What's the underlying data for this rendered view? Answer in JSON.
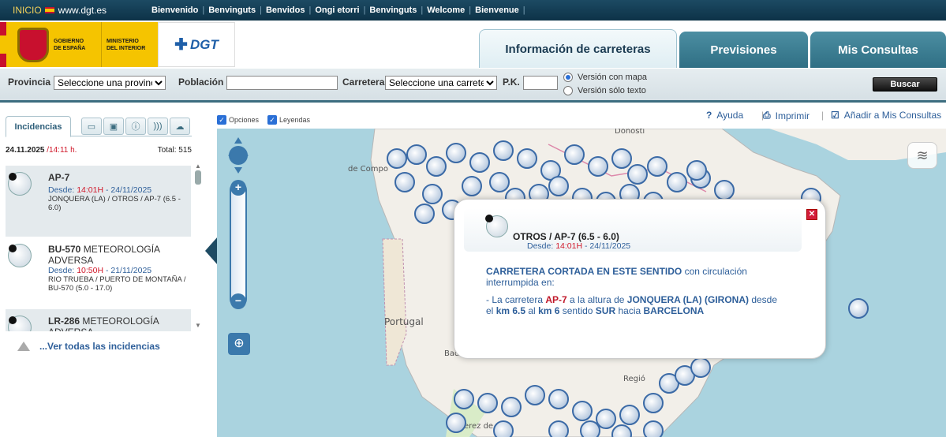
{
  "topbar": {
    "inicio": "INICIO",
    "site": "www.dgt.es",
    "languages": [
      "Bienvenido",
      "Benvinguts",
      "Benvidos",
      "Ongi etorri",
      "Benvinguts",
      "Welcome",
      "Bienvenue"
    ]
  },
  "header": {
    "gob_line1": "GOBIERNO",
    "gob_line2": "DE ESPAÑA",
    "min_line1": "MINISTERIO",
    "min_line2": "DEL INTERIOR",
    "dgt": "DGT",
    "tabs": [
      {
        "label": "Información de carreteras",
        "active": true
      },
      {
        "label": "Previsiones",
        "active": false
      },
      {
        "label": "Mis Consultas",
        "active": false
      }
    ]
  },
  "search": {
    "provincia_label": "Provincia",
    "provincia_value": "Seleccione una provincia",
    "poblacion_label": "Población",
    "poblacion_value": "",
    "carretera_label": "Carretera",
    "carretera_value": "Seleccione una carretera",
    "pk_label": "P.K.",
    "pk_value": "",
    "radio_map": "Versión con mapa",
    "radio_text": "Versión sólo texto",
    "radio_selected": "map",
    "buscar": "Buscar"
  },
  "left": {
    "tab_main": "Incidencias",
    "tab_icons": [
      "camera-icon",
      "message-sign-icon",
      "info-icon",
      "radio-icon",
      "weather-icon"
    ],
    "date": "24.11.2025",
    "time": "/14:11 h.",
    "total": "Total: 515",
    "incidents": [
      {
        "road": "AP-7",
        "type": "",
        "desde_prefix": "Desde: ",
        "hour": "14:01H",
        "date": " - 24/11/2025",
        "location": "JONQUERA (LA) / OTROS / AP-7 (6.5 - 6.0)",
        "selected": true
      },
      {
        "road": "BU-570",
        "type": " METEOROLOGÍA ADVERSA",
        "desde_prefix": "Desde: ",
        "hour": "10:50H",
        "date": " - 21/11/2025",
        "location": "RIO TRUEBA / PUERTO DE MONTAÑA / BU-570 (5.0 - 17.0)",
        "selected": false
      },
      {
        "road": "LR-286",
        "type": " METEOROLOGÍA ADVERSA",
        "desde_prefix": "",
        "hour": "",
        "date": "",
        "location": "",
        "selected": true
      }
    ],
    "see_all": "...Ver todas las incidencias"
  },
  "maptools": {
    "opciones": "Opciones",
    "leyendas": "Leyendas",
    "ayuda": "Ayuda",
    "imprimir": "Imprimir",
    "anadir": "Añadir a Mis Consultas"
  },
  "map": {
    "labels": [
      "Portugal",
      "Badaj",
      "Regió",
      "Jerez de",
      "de Compo",
      "Donosti"
    ],
    "colors": {
      "sea": "#aad3df",
      "land": "#f2efe9"
    }
  },
  "popup": {
    "title": "OTROS / AP-7 (6.5 - 6.0)",
    "desde_prefix": "Desde: ",
    "hour": "14:01H",
    "date": " - 24/11/2025",
    "body_bold": "CARRETERA CORTADA EN ESTE SENTIDO",
    "body_rest": " con circulación interrumpida en:",
    "detail": {
      "p1": "- La carretera ",
      "road": "AP-7",
      "p2": " a la altura de ",
      "place": "JONQUERA (LA) (GIRONA)",
      "p3": " desde el ",
      "km1": "km 6.5",
      "p4": " al ",
      "km2": "km 6",
      "p5": " sentido ",
      "dir": "SUR",
      "p6": " hacia ",
      "dest": "BARCELONA"
    }
  }
}
